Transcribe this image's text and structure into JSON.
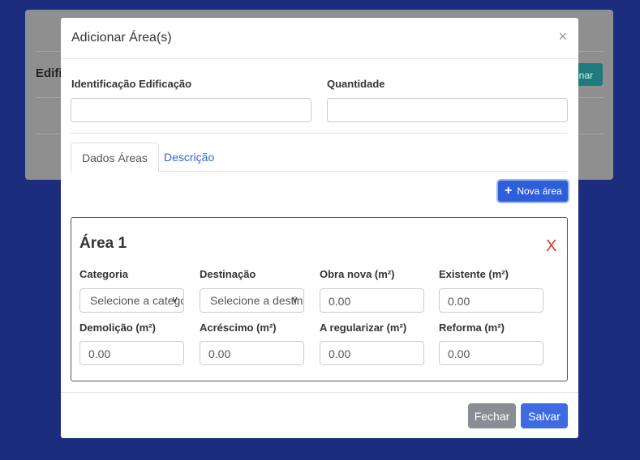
{
  "background": {
    "title": "Edifi",
    "button_label": "onar"
  },
  "modal": {
    "title": "Adicionar Área(s)",
    "close_symbol": "×",
    "fields": {
      "identificacao_label": "Identificação Edificação",
      "identificacao_value": "",
      "quantidade_label": "Quantidade",
      "quantidade_value": ""
    },
    "tabs": [
      "Dados Áreas",
      "Descrição"
    ],
    "new_area_label": "Nova área",
    "area": {
      "title": "Área 1",
      "remove_symbol": "X",
      "categoria_label": "Categoria",
      "categoria_value": "Selecione a categoria",
      "destinacao_label": "Destinação",
      "destinacao_value": "Selecione a destinação",
      "obra_nova_label": "Obra nova (m²)",
      "obra_nova_value": "0.00",
      "existente_label": "Existente (m²)",
      "existente_value": "0.00",
      "demolicao_label": "Demolição (m²)",
      "demolicao_value": "0.00",
      "acrescimo_label": "Acréscimo (m²)",
      "acrescimo_value": "0.00",
      "regularizar_label": "A regularizar (m²)",
      "regularizar_value": "0.00",
      "reforma_label": "Reforma (m²)",
      "reforma_value": "0.00"
    },
    "footer": {
      "close_label": "Fechar",
      "save_label": "Salvar"
    }
  },
  "colors": {
    "backdrop": "#1b2d7c",
    "primary": "#3e6be0",
    "danger": "#e03a2f",
    "secondary": "#8a8d93"
  }
}
